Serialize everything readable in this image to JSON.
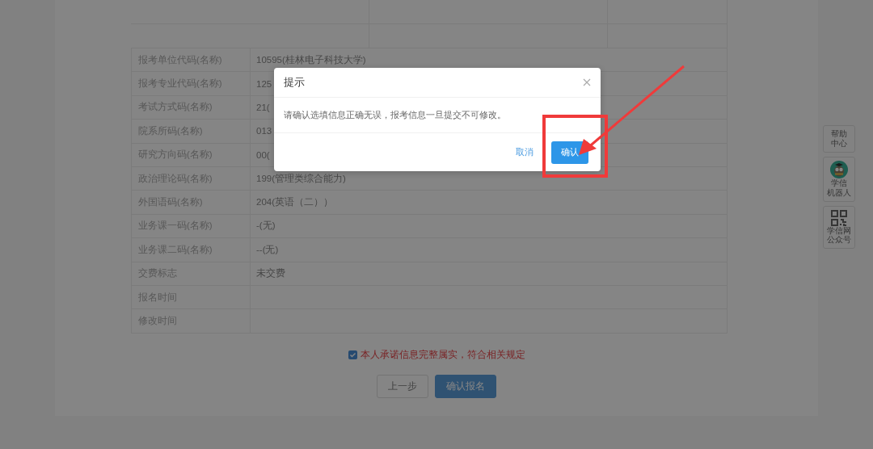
{
  "info_table": {
    "rows": [
      {
        "label": "报考单位代码(名称)",
        "value": "10595(桂林电子科技大学)"
      },
      {
        "label": "报考专业代码(名称)",
        "value": "125"
      },
      {
        "label": "考试方式码(名称)",
        "value": "21("
      },
      {
        "label": "院系所码(名称)",
        "value": "013"
      },
      {
        "label": "研究方向码(名称)",
        "value": "00("
      },
      {
        "label": "政治理论码(名称)",
        "value": "199(管理类综合能力)"
      },
      {
        "label": "外国语码(名称)",
        "value": "204(英语（二））"
      },
      {
        "label": "业务课一码(名称)",
        "value": "-(无)"
      },
      {
        "label": "业务课二码(名称)",
        "value": "--(无)"
      },
      {
        "label": "交费标志",
        "value": "未交费"
      },
      {
        "label": "报名时间"
      },
      {
        "label": "修改时间"
      }
    ]
  },
  "pledge": {
    "checked": true,
    "text": "本人承诺信息完整属实，符合相关规定"
  },
  "buttons": [
    {
      "label": "上一步",
      "kind": "secondary"
    },
    {
      "label": "确认报名",
      "kind": "primary"
    }
  ],
  "side_tools": [
    {
      "lines": [
        "帮助",
        "中心"
      ],
      "kind": "text"
    },
    {
      "lines": [
        "学信",
        "机器人"
      ],
      "kind": "avatar"
    },
    {
      "lines": [
        "学信网",
        "公众号"
      ],
      "kind": "qr"
    }
  ],
  "dialog": {
    "title": "提示",
    "message": "请确认选填信息正确无误，报考信息一旦提交不可修改。",
    "buttons": [
      {
        "label": "取消",
        "kind": "text"
      },
      {
        "label": "确认",
        "kind": "primary"
      }
    ]
  }
}
